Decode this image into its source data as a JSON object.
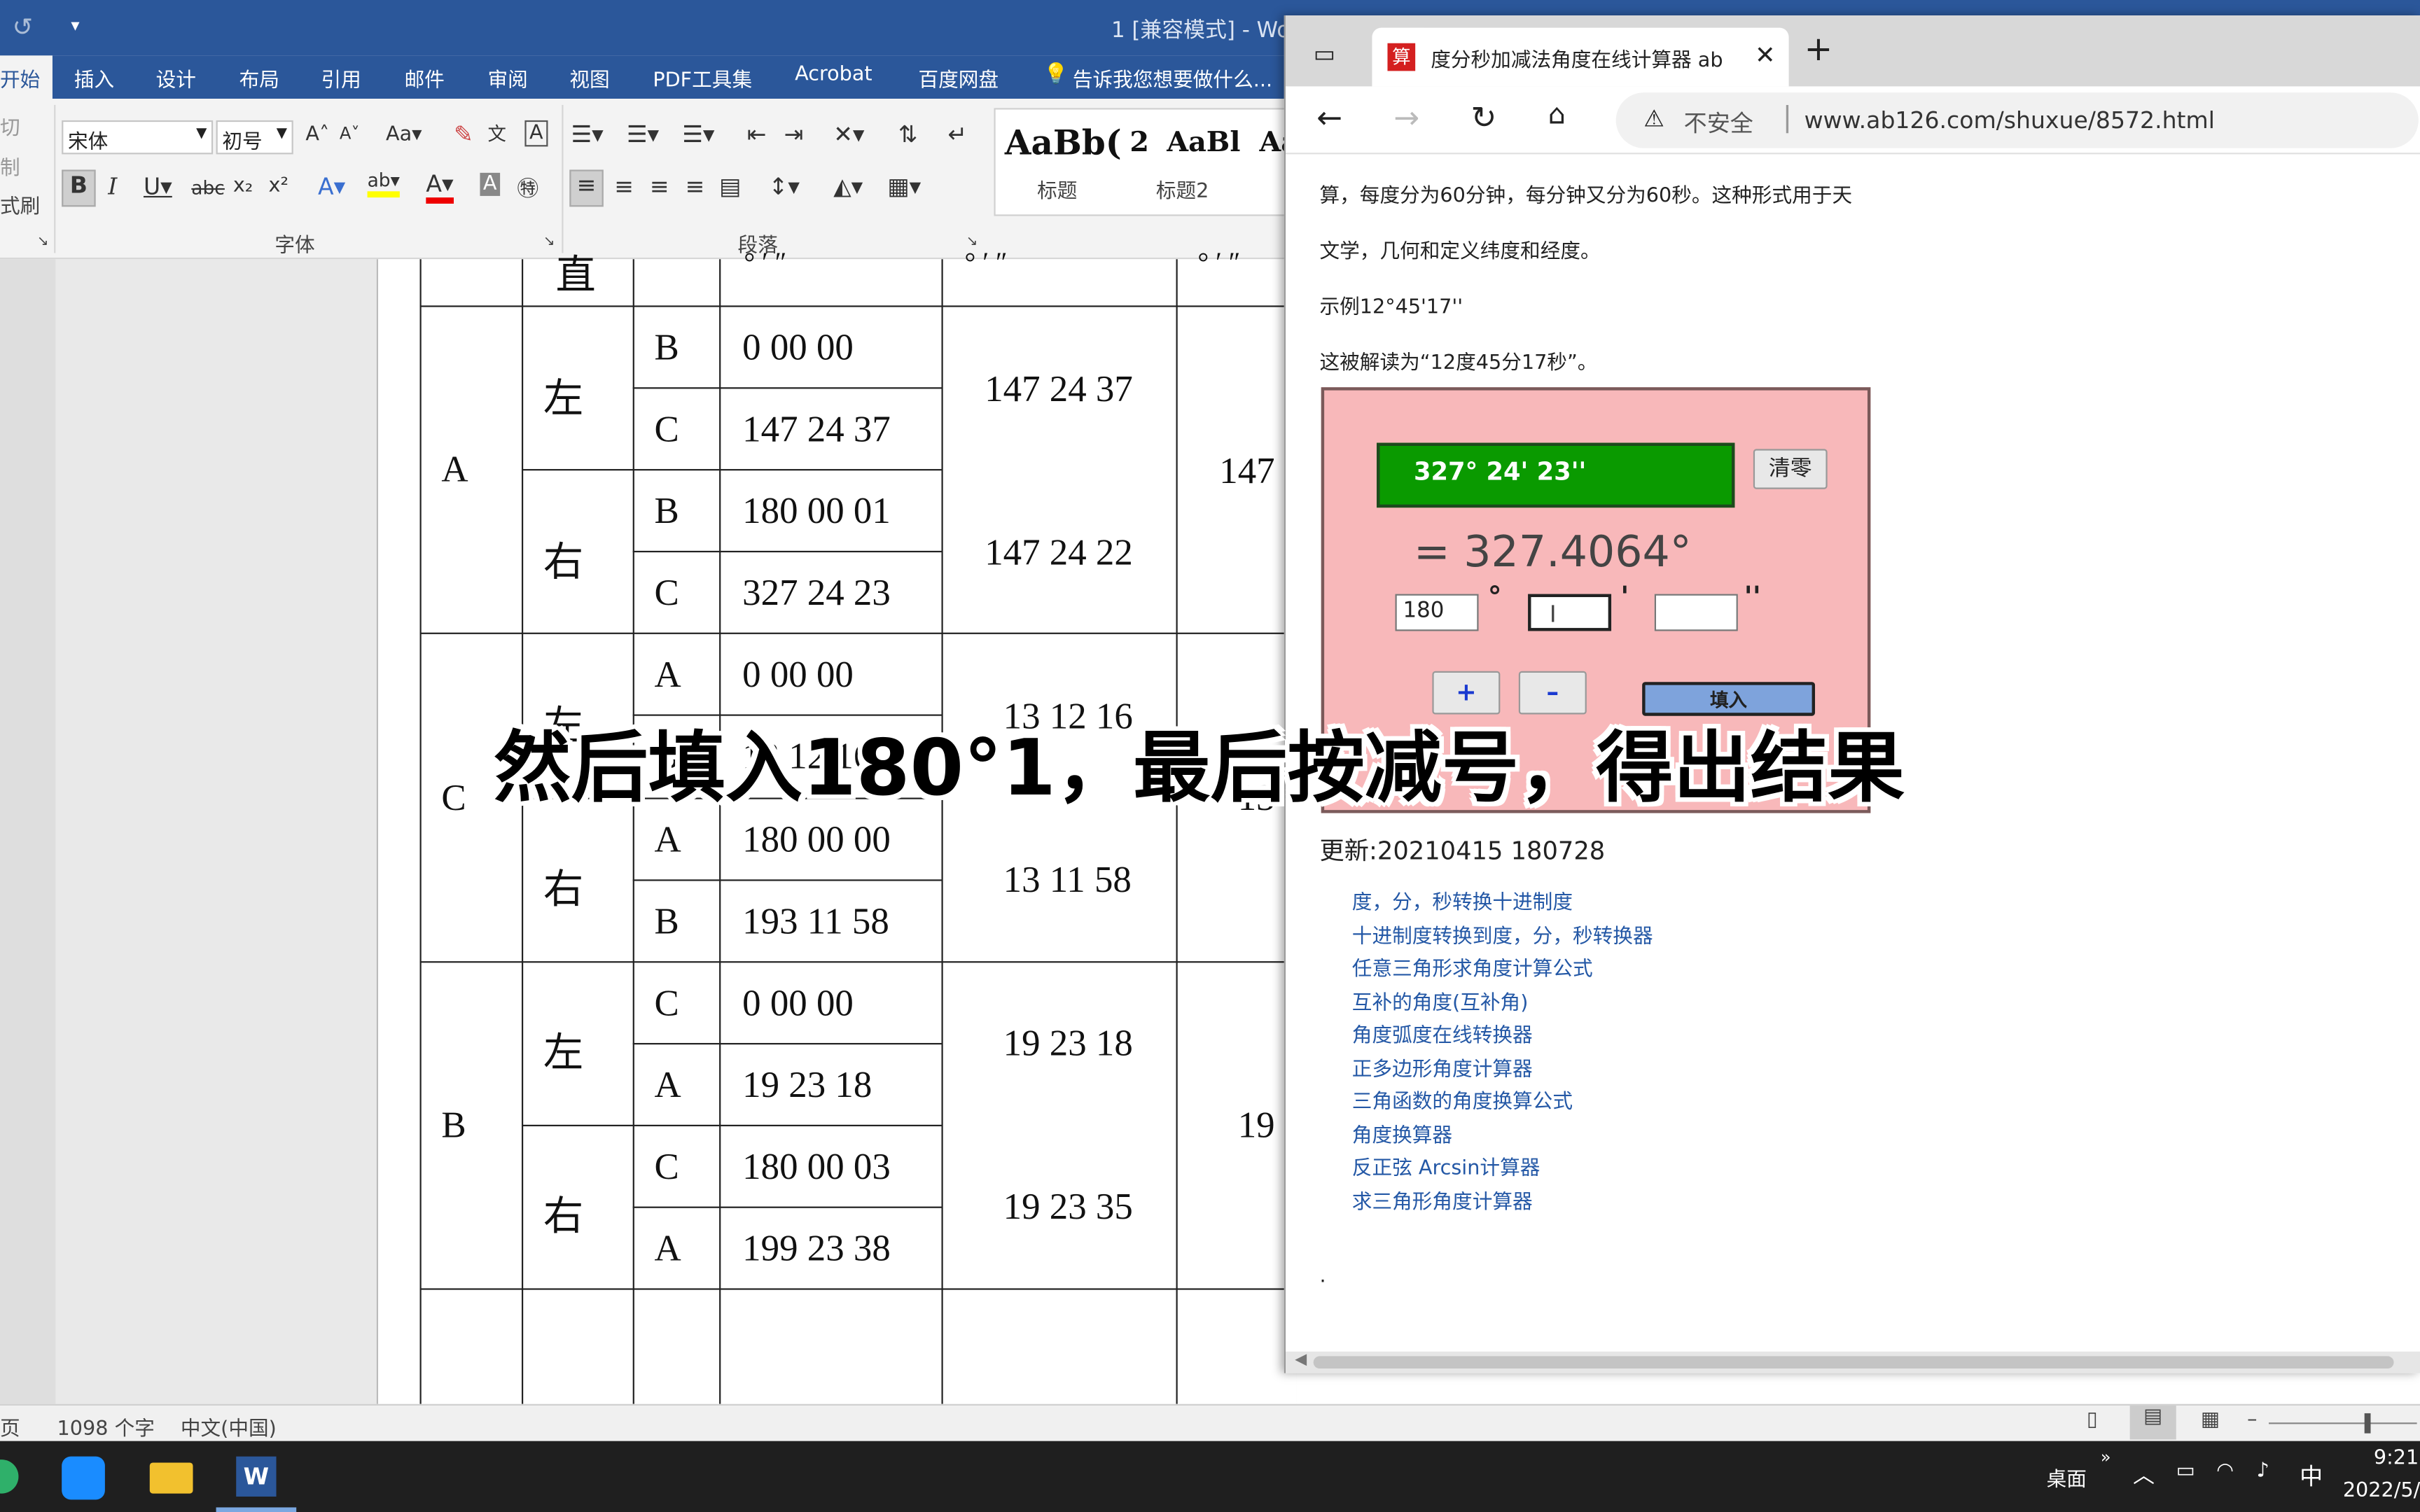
{
  "word": {
    "title": "1 [兼容模式] - Wo",
    "tabs": [
      "开始",
      "插入",
      "设计",
      "布局",
      "引用",
      "邮件",
      "审阅",
      "视图",
      "PDF工具集",
      "Acrobat",
      "百度网盘"
    ],
    "tell_me": "告诉我您想要做什么...",
    "clipboard": [
      "切",
      "制",
      "式刷"
    ],
    "font_name": "宋体",
    "font_size": "初号",
    "group_font": "字体",
    "group_paragraph": "段落",
    "styles": [
      {
        "sample": "AaBb(",
        "label": "标题"
      },
      {
        "sample": "2",
        "label": ""
      },
      {
        "sample": "AaBl",
        "label": "标题2"
      },
      {
        "sample": "Aa",
        "label": ""
      }
    ],
    "status": {
      "pages": "页",
      "words": "1098 个字",
      "lang": "中文(中国)"
    }
  },
  "table": {
    "top_row": {
      "c1": "直",
      "c2": "° ′ ″",
      "c3": "° ′ ″",
      "c4": "° ′ ″"
    },
    "groups": [
      {
        "station": "A",
        "halves": [
          {
            "side": "左",
            "rows": [
              {
                "t": "B",
                "r": "0 00 00"
              },
              {
                "t": "C",
                "r": "147 24 37"
              }
            ],
            "half": "147 24 37"
          },
          {
            "side": "右",
            "rows": [
              {
                "t": "B",
                "r": "180 00 01"
              },
              {
                "t": "C",
                "r": "327 24 23"
              }
            ],
            "half": "147 24 22"
          }
        ],
        "one": "147"
      },
      {
        "station": "C",
        "halves": [
          {
            "side": "左",
            "rows": [
              {
                "t": "A",
                "r": "0 00 00"
              },
              {
                "t": "B",
                "r": "13 12 16"
              }
            ],
            "half": "13 12 16"
          },
          {
            "side": "右",
            "rows": [
              {
                "t": "A",
                "r": "180 00 00"
              },
              {
                "t": "B",
                "r": "193 11 58"
              }
            ],
            "half": "13 11 58"
          }
        ],
        "one": "13"
      },
      {
        "station": "B",
        "halves": [
          {
            "side": "左",
            "rows": [
              {
                "t": "C",
                "r": "0 00 00"
              },
              {
                "t": "A",
                "r": "19 23 18"
              }
            ],
            "half": "19 23 18"
          },
          {
            "side": "右",
            "rows": [
              {
                "t": "C",
                "r": "180 00 03"
              },
              {
                "t": "A",
                "r": "199 23 38"
              }
            ],
            "half": "19 23 35"
          }
        ],
        "one": "19"
      }
    ]
  },
  "browser": {
    "tab_title": "度分秒加减法角度在线计算器 ab",
    "tab_icon_glyph": "算",
    "insecure": "不安全",
    "url": "www.ab126.com/shuxue/8572.html",
    "paras": [
      "算，每度分为60分钟，每分钟又分为60秒。这种形式用于天",
      "文学，几何和定义纬度和经度。",
      "示例12°45'17''",
      "这被解读为“12度45分17秒”。"
    ],
    "calc": {
      "display": "327°  24'  23''",
      "clear": "清零",
      "result": "= 327.4064°",
      "deg": "180",
      "min": "",
      "sec": "",
      "deg_sym": "°",
      "min_sym": "'",
      "sec_sym": "''",
      "plus": "+",
      "minus": "–",
      "fill": "填入"
    },
    "updated": "更新:20210415 180728",
    "links": [
      "度，分，秒转换十进制度",
      "十进制度转换到度，分，秒转换器",
      "任意三角形求角度计算公式",
      "互补的角度(互补角)",
      "角度弧度在线转换器",
      "正多边形角度计算器",
      "三角函数的角度换算公式",
      "角度换算器",
      "反正弦 Arcsin计算器",
      "求三角形角度计算器"
    ],
    "dot": "."
  },
  "taskbar": {
    "desktop": "桌面",
    "ime": "中",
    "time": "9:21",
    "date": "2022/5/"
  },
  "caption": "然后填入180°1，最后按减号，得出结果"
}
